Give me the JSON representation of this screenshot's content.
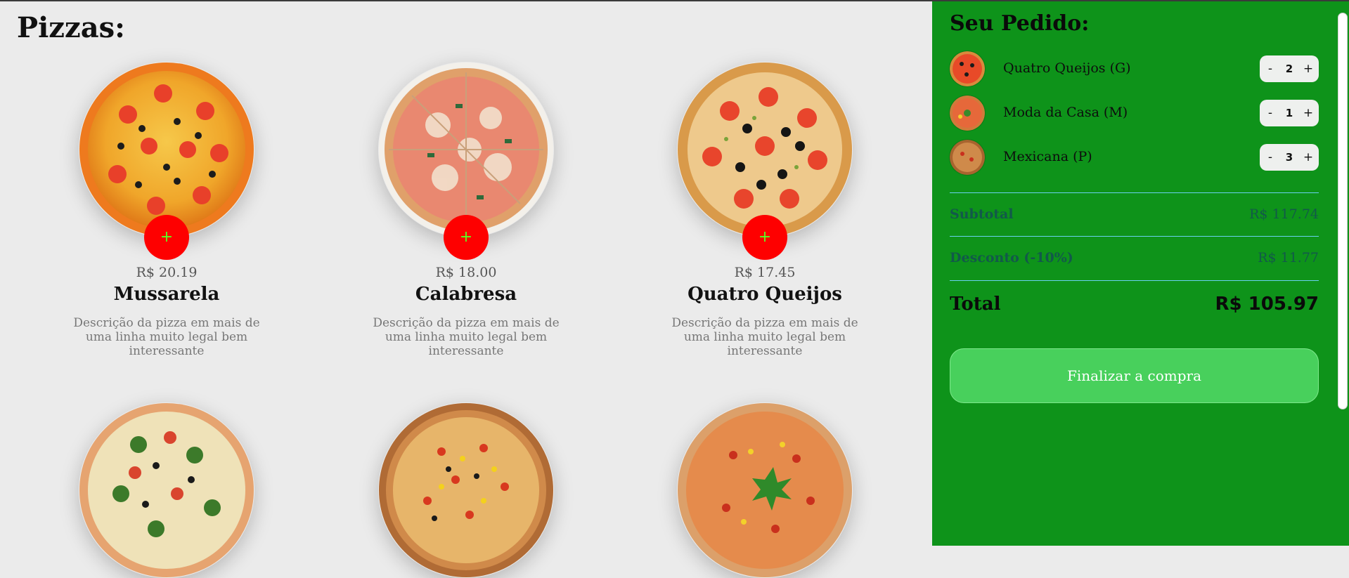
{
  "menu": {
    "title": "Pizzas:",
    "add_label": "+",
    "pizzas": [
      {
        "name": "Mussarela",
        "price": "R$ 20.19",
        "description": "Descrição da pizza em mais de uma linha muito legal bem interessante"
      },
      {
        "name": "Calabresa",
        "price": "R$ 18.00",
        "description": "Descrição da pizza em mais de uma linha muito legal bem interessante"
      },
      {
        "name": "Quatro Queijos",
        "price": "R$ 17.45",
        "description": "Descrição da pizza em mais de uma linha muito legal bem interessante"
      },
      {
        "name": "",
        "price": "",
        "description": ""
      },
      {
        "name": "",
        "price": "",
        "description": ""
      },
      {
        "name": "",
        "price": "",
        "description": ""
      }
    ]
  },
  "cart": {
    "title": "Seu Pedido:",
    "minus_label": "-",
    "plus_label": "+",
    "items": [
      {
        "name": "Quatro Queijos (G)",
        "quantity": "2"
      },
      {
        "name": "Moda da Casa (M)",
        "quantity": "1"
      },
      {
        "name": "Mexicana (P)",
        "quantity": "3"
      }
    ],
    "subtotal_label": "Subtotal",
    "subtotal_value": "R$ 117.74",
    "discount_label": "Desconto (-10%)",
    "discount_value": "R$ 11.77",
    "total_label": "Total",
    "total_value": "R$ 105.97",
    "checkout_label": "Finalizar a compra"
  },
  "colors": {
    "page_bg": "#ebebeb",
    "sidebar_bg": "#0e931a",
    "add_button": "#fe0000",
    "add_button_plus": "#59ff21",
    "checkout_button": "#48d05c",
    "divider": "#6ad1f0"
  },
  "icons": {
    "add": "plus-icon",
    "scroll": "scrollbar"
  }
}
